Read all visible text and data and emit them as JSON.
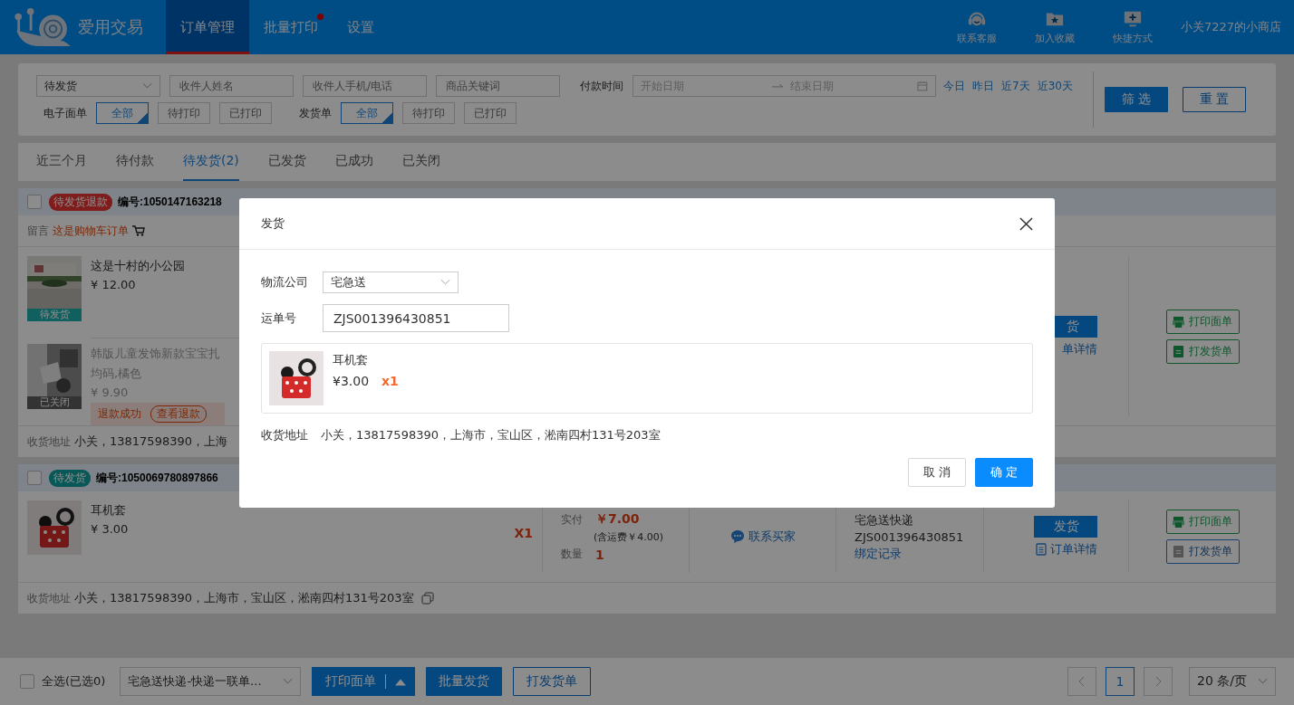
{
  "header": {
    "brand": "爱用交易",
    "nav": [
      {
        "label": "订单管理",
        "selected": true,
        "dot": false
      },
      {
        "label": "批量打印",
        "selected": false,
        "dot": true
      },
      {
        "label": "设置",
        "selected": false,
        "dot": false
      }
    ],
    "quick_links": [
      {
        "label": "联系客服",
        "kind": "service"
      },
      {
        "label": "加入收藏",
        "kind": "favorite"
      },
      {
        "label": "快捷方式",
        "kind": "shortcut"
      }
    ],
    "shop_name": "小关7227的小商店"
  },
  "filters": {
    "status_select": "待发货",
    "inputs": [
      {
        "placeholder": "收件人姓名"
      },
      {
        "placeholder": "收件人手机/电话"
      },
      {
        "placeholder": "商品关键词"
      }
    ],
    "pay_time_label": "付款时间",
    "date_start": {
      "placeholder": "开始日期"
    },
    "date_end": {
      "placeholder": "结束日期"
    },
    "quick_dates": [
      "今日",
      "昨日",
      "近7天",
      "近30天"
    ],
    "filter_button": "筛 选",
    "reset_button": "重 置",
    "toggle_groups": [
      {
        "label": "电子面单",
        "options": [
          {
            "label": "全部",
            "selected": true
          },
          {
            "label": "待打印",
            "selected": false
          },
          {
            "label": "已打印",
            "selected": false
          }
        ]
      },
      {
        "label": "发货单",
        "options": [
          {
            "label": "全部",
            "selected": true
          },
          {
            "label": "待打印",
            "selected": false
          },
          {
            "label": "已打印",
            "selected": false
          }
        ]
      }
    ]
  },
  "order_tabs": [
    {
      "label": "近三个月",
      "selected": false
    },
    {
      "label": "待付款",
      "selected": false
    },
    {
      "label": "待发货(2)",
      "selected": true
    },
    {
      "label": "已发货",
      "selected": false
    },
    {
      "label": "已成功",
      "selected": false
    },
    {
      "label": "已关闭",
      "selected": false
    }
  ],
  "orders": [
    {
      "checked": false,
      "badge": {
        "label": "待发货退款",
        "kind": "refund"
      },
      "number": "编号:1050147163218",
      "message": {
        "label": "留言",
        "text": "这是购物车订单"
      },
      "items": [
        {
          "title": "这是十村的小公园",
          "price": "¥ 12.00",
          "status": "待发货",
          "closed": false
        },
        {
          "title": "韩版儿童发饰新款宝宝扎",
          "spec": "均码,橘色",
          "price": "¥ 9.90",
          "status": "已关闭",
          "closed": true,
          "refund": {
            "status": "退款成功",
            "button": "查看退款"
          }
        }
      ],
      "action": {
        "button": "货",
        "detail": "单详情",
        "detail_icon": false
      },
      "prints": [
        {
          "label": "打印面单",
          "kind": "waybill",
          "printed": true
        },
        {
          "label": "打发货单",
          "kind": "invoice",
          "printed": true
        }
      ],
      "address": {
        "label": "收货地址",
        "text": "小关，13817598390，上海",
        "copy": false
      }
    },
    {
      "checked": false,
      "badge": {
        "label": "待发货",
        "kind": "pending"
      },
      "number": "编号:1050069780897866",
      "items": [
        {
          "title": "耳机套",
          "price": "¥ 3.00",
          "closed": false
        }
      ],
      "quantity_mark": "X1",
      "payment": {
        "paid_label": "实付",
        "paid": "￥7.00",
        "shipping": "(含运费￥4.00)",
        "qty_label": "数量",
        "qty": "1"
      },
      "contact": "联系买家",
      "logistics": {
        "company": "宅急送快递",
        "tracking": "ZJS001396430851",
        "link": "绑定记录"
      },
      "action": {
        "button": "发货",
        "detail": "订单详情",
        "detail_icon": true
      },
      "prints": [
        {
          "label": "打印面单",
          "kind": "waybill",
          "printed": true
        },
        {
          "label": "打发货单",
          "kind": "invoice",
          "printed": false
        }
      ],
      "address": {
        "label": "收货地址",
        "text": "小关，13817598390，上海市，宝山区，淞南四村131号203室",
        "copy": true
      }
    }
  ],
  "footer": {
    "select_all": {
      "label": "全选(已选0)",
      "checked": false
    },
    "template": "宅急送快递-快递一联单...",
    "print_button": "打印面单",
    "ship_button": "批量发货",
    "invoice_button": "打发货单",
    "pages": [
      {
        "label": "1",
        "selected": true
      }
    ],
    "page_size": "20 条/页"
  },
  "dialog": {
    "title": "发货",
    "fields": [
      {
        "label": "物流公司",
        "kind": "select",
        "value": "宅急送"
      },
      {
        "label": "运单号",
        "kind": "input",
        "value": "ZJS001396430851"
      }
    ],
    "product": {
      "title": "耳机套",
      "price": "¥3.00",
      "qty": "x1"
    },
    "address": {
      "label": "收货地址",
      "text": "小关，13817598390，上海市，宝山区，淞南四村131号203室"
    },
    "buttons": [
      {
        "label": "取 消",
        "kind": "cancel"
      },
      {
        "label": "确 定",
        "kind": "primary"
      }
    ]
  }
}
